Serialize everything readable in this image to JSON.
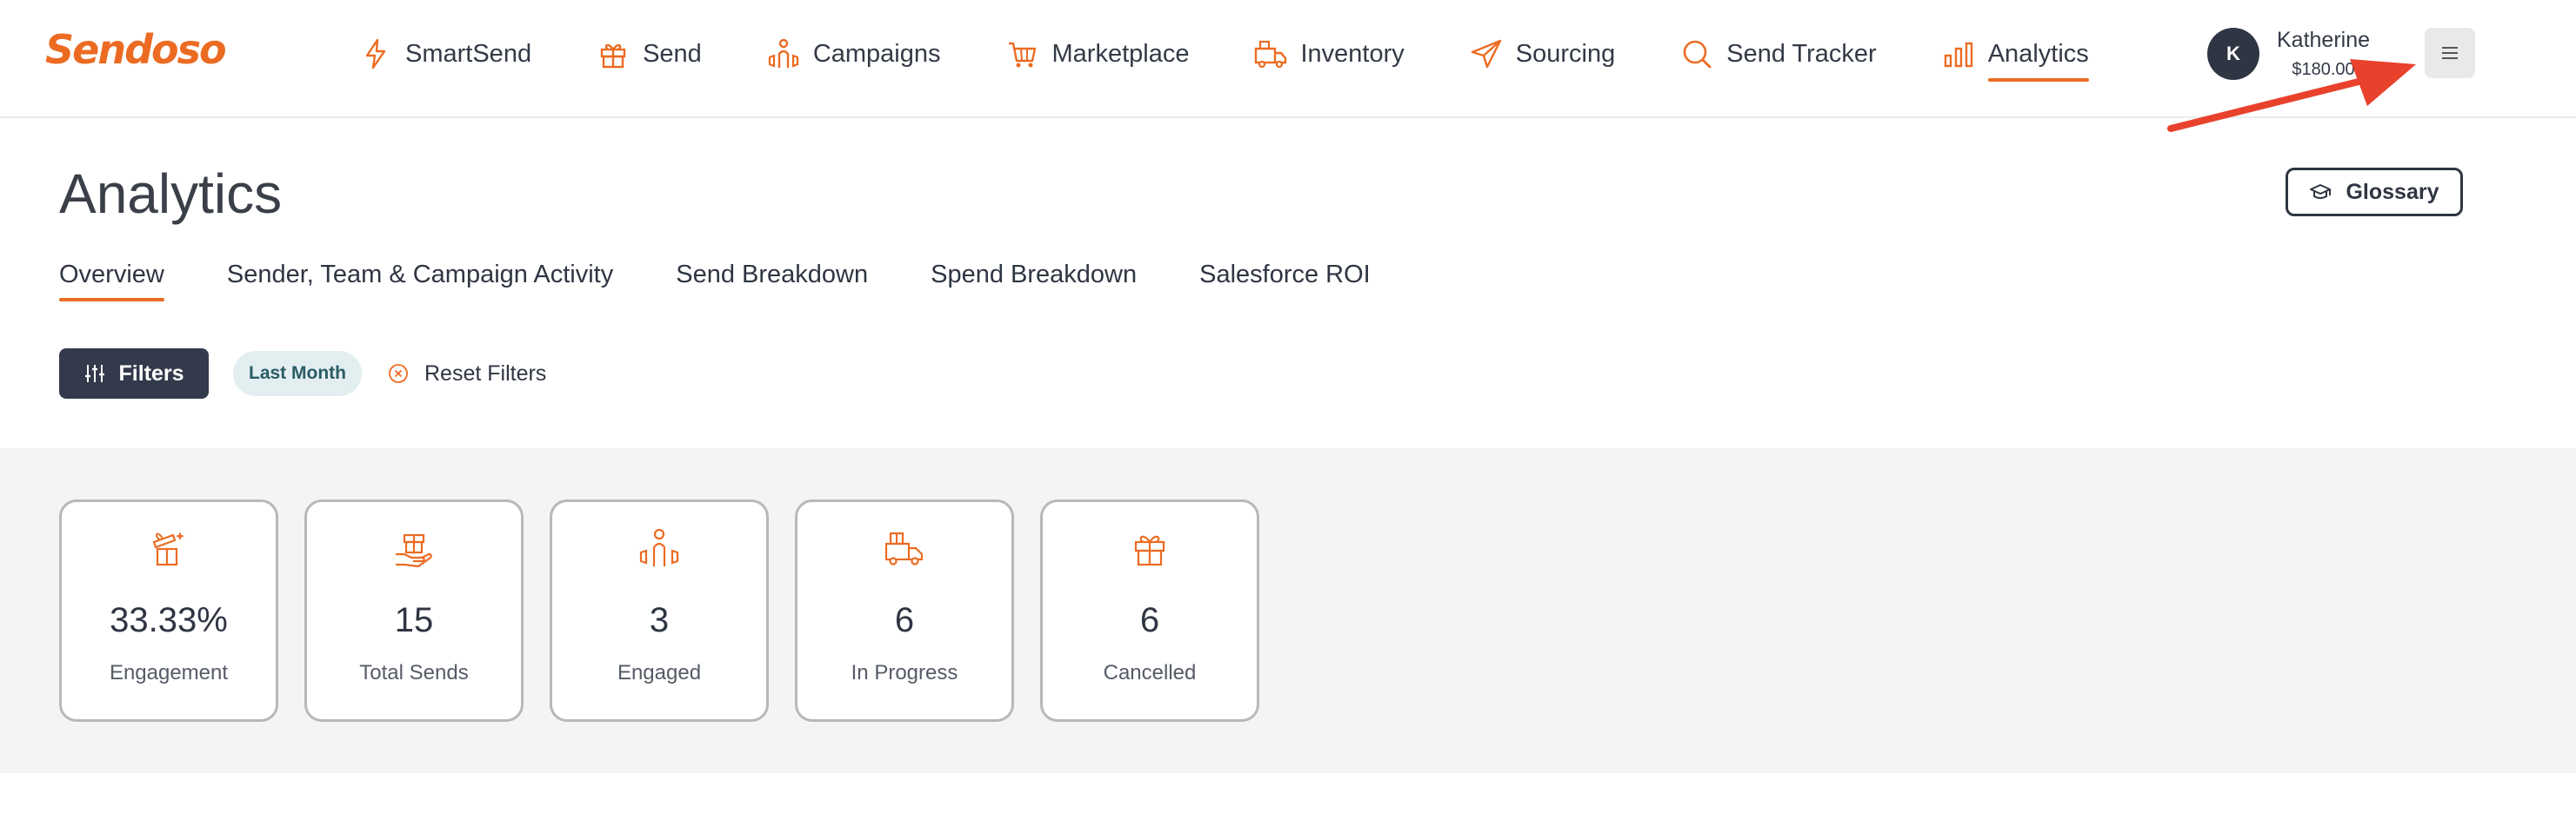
{
  "brand": {
    "logo_text": "Sendoso",
    "accent": "#ec6b22"
  },
  "nav": {
    "items": [
      {
        "label": "SmartSend",
        "icon": "lightning-icon"
      },
      {
        "label": "Send",
        "icon": "gift-icon"
      },
      {
        "label": "Campaigns",
        "icon": "campaigns-icon"
      },
      {
        "label": "Marketplace",
        "icon": "cart-icon"
      },
      {
        "label": "Inventory",
        "icon": "inventory-truck-icon"
      },
      {
        "label": "Sourcing",
        "icon": "paper-plane-icon"
      },
      {
        "label": "Send Tracker",
        "icon": "search-icon"
      },
      {
        "label": "Analytics",
        "icon": "bar-chart-icon"
      }
    ],
    "active": "Analytics"
  },
  "user": {
    "initial": "K",
    "name": "Katherine",
    "balance": "$180.00"
  },
  "page": {
    "title": "Analytics",
    "glossary_label": "Glossary"
  },
  "tabs": [
    {
      "label": "Overview"
    },
    {
      "label": "Sender, Team & Campaign Activity"
    },
    {
      "label": "Send Breakdown"
    },
    {
      "label": "Spend Breakdown"
    },
    {
      "label": "Salesforce ROI"
    }
  ],
  "filters": {
    "button_label": "Filters",
    "chip_label": "Last Month",
    "reset_label": "Reset Filters"
  },
  "stats": [
    {
      "value": "33.33%",
      "label": "Engagement",
      "icon": "gift-open-icon"
    },
    {
      "value": "15",
      "label": "Total Sends",
      "icon": "gift-hand-icon"
    },
    {
      "value": "3",
      "label": "Engaged",
      "icon": "person-engaged-icon"
    },
    {
      "value": "6",
      "label": "In Progress",
      "icon": "delivery-truck-icon"
    },
    {
      "value": "6",
      "label": "Cancelled",
      "icon": "gift-icon"
    }
  ]
}
